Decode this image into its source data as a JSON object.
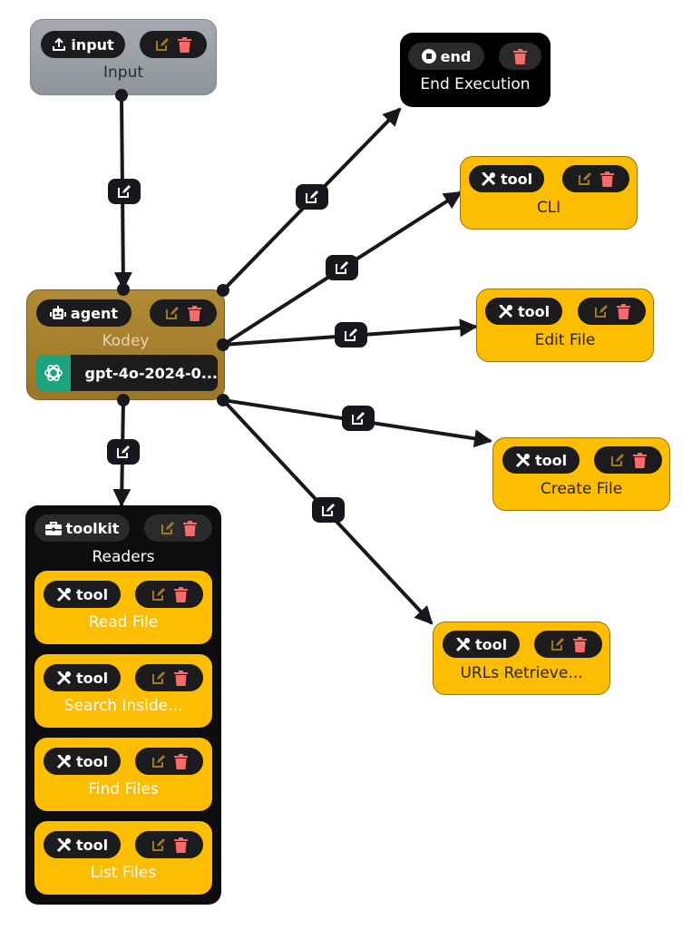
{
  "colors": {
    "edge": "#16181d",
    "tool_bg": "#fdbd00",
    "agent_bg": "#a8802e",
    "input_bg": "#9a9ea4",
    "end_bg": "#000000",
    "toolkit_bg": "#0d0d0f",
    "edit_icon": "#a07a1e",
    "delete_icon": "#f76b6b",
    "model_logo_bg": "#1ea37c"
  },
  "nodes": {
    "input": {
      "type_label": "input",
      "type_icon": "upload-icon",
      "label": "Input"
    },
    "end": {
      "type_label": "end",
      "type_icon": "stop-circle-icon",
      "label": "End Execution"
    },
    "agent": {
      "type_label": "agent",
      "type_icon": "robot-icon",
      "label": "Kodey",
      "model": {
        "icon": "openai-icon",
        "name": "gpt-4o-2024-0..."
      }
    },
    "cli": {
      "type_label": "tool",
      "type_icon": "tools-icon",
      "label": "CLI"
    },
    "edit_file": {
      "type_label": "tool",
      "type_icon": "tools-icon",
      "label": "Edit File"
    },
    "create_file": {
      "type_label": "tool",
      "type_icon": "tools-icon",
      "label": "Create File"
    },
    "urls_retriever": {
      "type_label": "tool",
      "type_icon": "tools-icon",
      "label": "URLs Retrieve..."
    },
    "toolkit": {
      "type_label": "toolkit",
      "type_icon": "toolbox-icon",
      "label": "Readers",
      "tools": [
        {
          "type_label": "tool",
          "label": "Read File"
        },
        {
          "type_label": "tool",
          "label": "Search Inside..."
        },
        {
          "type_label": "tool",
          "label": "Find Files"
        },
        {
          "type_label": "tool",
          "label": "List Files"
        }
      ]
    }
  },
  "edges": [
    {
      "from": "input",
      "to": "agent",
      "action": "edit-edge"
    },
    {
      "from": "agent",
      "to": "end",
      "action": "edit-edge"
    },
    {
      "from": "agent",
      "to": "cli",
      "action": "edit-edge"
    },
    {
      "from": "agent",
      "to": "edit_file",
      "action": "edit-edge"
    },
    {
      "from": "agent",
      "to": "create_file",
      "action": "edit-edge"
    },
    {
      "from": "agent",
      "to": "urls_retriever",
      "action": "edit-edge"
    },
    {
      "from": "agent",
      "to": "toolkit",
      "action": "edit-edge"
    }
  ]
}
